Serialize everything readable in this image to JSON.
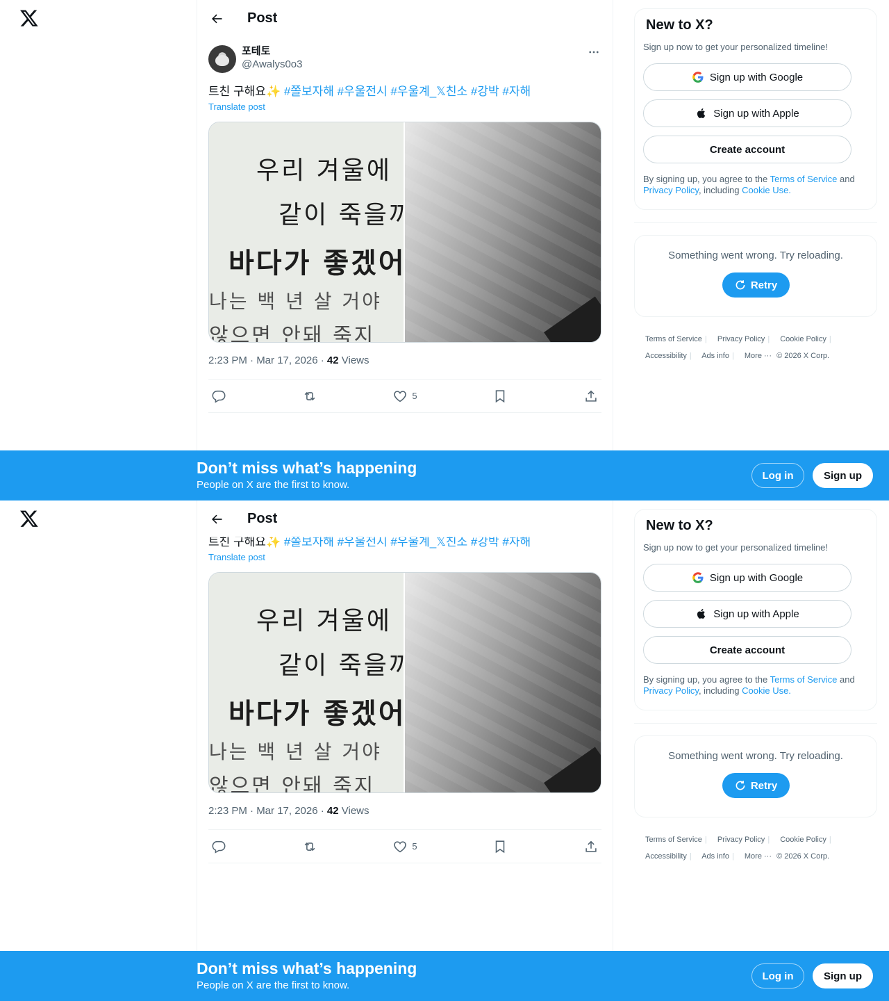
{
  "app": {
    "logo_icon": "x-logo-icon"
  },
  "header": {
    "title": "Post"
  },
  "post": {
    "display_name": "포테토",
    "handle": "@Awalys0o3",
    "text_prefix": "트친 구해요",
    "sparkle": "✨",
    "hashtags": [
      "#쫄보자해",
      "#우울전시",
      "#우울계_𝕏친소",
      "#강박",
      "#자해"
    ],
    "translate_label": "Translate post",
    "image_lines": [
      "우리 겨울에",
      "같이 죽을까",
      "바다가 좋겠어",
      "나는 백 년 살 거야",
      "않으면 안돼 죽지"
    ],
    "time": "2:23 PM · Mar 17, 2026 · ",
    "views_count": "42",
    "views_label": " Views",
    "likes": "5"
  },
  "sidebar": {
    "title": "New to X?",
    "subtitle": "Sign up now to get your personalized timeline!",
    "google_label": "Sign up with Google",
    "apple_label": "Sign up with Apple",
    "create_label": "Create account",
    "legal_1": "By signing up, you agree to the ",
    "tos": "Terms of Service",
    "legal_2": " and ",
    "privacy": "Privacy Policy",
    "legal_3": ", including ",
    "cookie": "Cookie Use.",
    "error_msg": "Something went wrong. Try reloading.",
    "retry_label": "Retry",
    "footer": [
      "Terms of Service",
      "Privacy Policy",
      "Cookie Policy",
      "Accessibility",
      "Ads info",
      "More ···",
      "© 2026 X Corp."
    ]
  },
  "banner": {
    "title": "Don’t miss what’s happening",
    "subtitle": "People on X are the first to know.",
    "login_label": "Log in",
    "signup_label": "Sign up"
  },
  "colors": {
    "accent": "#1d9bf0",
    "text": "#0f1419",
    "muted": "#536471"
  }
}
